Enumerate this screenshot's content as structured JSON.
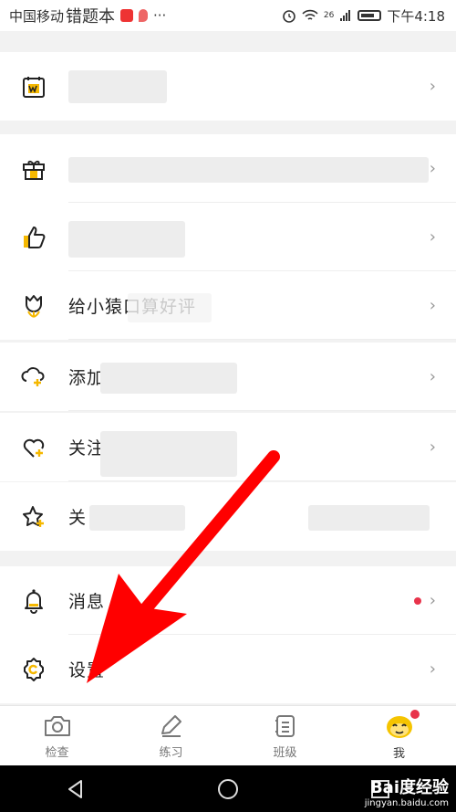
{
  "status_bar": {
    "carrier": "中国移动",
    "overlay_title": "错题本",
    "signal": "26",
    "time": "下午4:18",
    "more": "···"
  },
  "menu": {
    "items": [
      {
        "label": "",
        "icon": "calendar-w-icon"
      },
      {
        "label": "",
        "icon": "gift-icon"
      },
      {
        "label": "",
        "icon": "thumbs-up-icon"
      },
      {
        "label": "给小猿口算好评",
        "icon": "tulip-icon"
      },
      {
        "label": "添加",
        "icon": "cloud-add-icon"
      },
      {
        "label": "关注",
        "icon": "heart-add-icon"
      },
      {
        "label": "关",
        "icon": "star-add-icon"
      },
      {
        "label": "消息",
        "icon": "bell-icon"
      },
      {
        "label": "设置",
        "icon": "gear-icon"
      }
    ],
    "chevron": "›"
  },
  "tabs": [
    {
      "label": "检查",
      "icon": "camera-icon"
    },
    {
      "label": "练习",
      "icon": "pencil-icon"
    },
    {
      "label": "班级",
      "icon": "list-icon"
    },
    {
      "label": "我",
      "icon": "monkey-face-icon"
    }
  ],
  "watermark": {
    "line1": "Bai度经验",
    "line2": "jingyan.baidu.com"
  },
  "colors": {
    "accent": "#f5b800",
    "badge_red": "#e8334b",
    "arrow_red": "#ff0000"
  }
}
